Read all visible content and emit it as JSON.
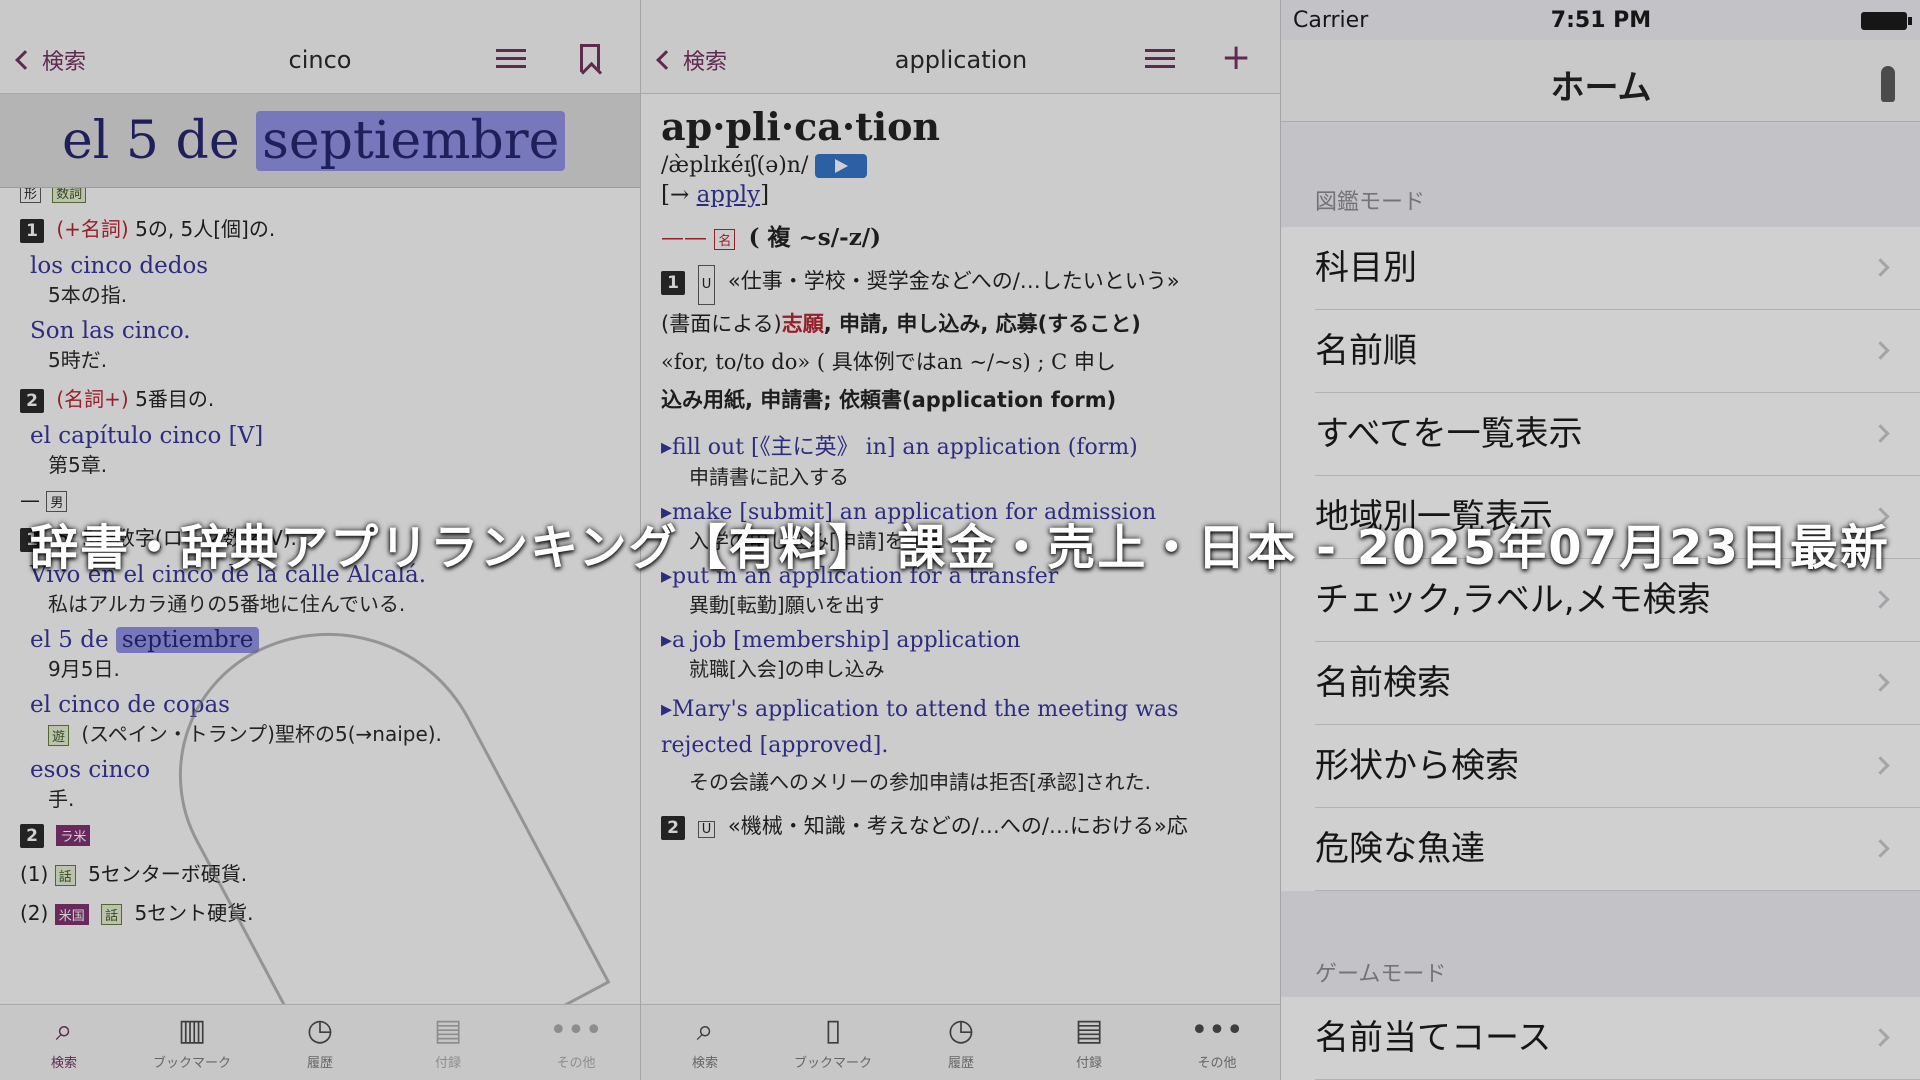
{
  "banner": "辞書・辞典アプリランキング【有料】 課金・売上・日本 - 2025年07月23日最新",
  "left": {
    "back_label": "検索",
    "title": "cinco",
    "magnifier": {
      "prefix": "el 5 de ",
      "highlight": "septiembre"
    },
    "entries": {
      "tags_top": [
        "形",
        "数詞"
      ],
      "s1_num": "1",
      "s1_head": "(+名詞)",
      "s1_text": "5の, 5人[個]の.",
      "e1_en": "los cinco dedos",
      "e1_jp": "5本の指.",
      "e2_en": "Son las cinco.",
      "e2_jp": "5時だ.",
      "s2_num": "2",
      "s2_head": "(名詞+)",
      "s2_text": "5番目の.",
      "e3_en": "el capítulo cinco [V]",
      "e3_jp": "第5章.",
      "male_tag": "男",
      "s3_num": "1",
      "s3_text": "5; 5の数字(ローマ数字 V).",
      "e4_en": "Vivo en el cinco de la calle Alcalá.",
      "e4_jp": "私はアルカラ通りの5番地に住んでいる.",
      "e5_en_a": "el 5 de ",
      "e5_en_hl": "septiembre",
      "e5_jp": "9月5日.",
      "e6_en": "el cinco de copas",
      "e6_tag": "遊",
      "e6_jp": "(スペイン・トランプ)聖杯の5(→naipe).",
      "e7_en": "esos cinco",
      "e7_jp": "手.",
      "s4_num": "2",
      "s4_tag": "ラ米",
      "s4a_label": "(1)",
      "s4a_tag": "話",
      "s4a_text": "5センターボ硬貨.",
      "s4b_label": "(2)",
      "s4b_tag1": "米国",
      "s4b_tag2": "話",
      "s4b_text": "5セント硬貨."
    },
    "tabs": [
      "検索",
      "ブックマーク",
      "履歴",
      "付録",
      "その他"
    ]
  },
  "middle": {
    "back_label": "検索",
    "title": "application",
    "headword": "ap·pli·ca·tion",
    "pron": "/æ̀plɪkéɪʃ(ə)n/",
    "xref_label": "[→ ",
    "xref_word": "apply",
    "xref_end": "]",
    "pos": "名",
    "pos_plural": "( 複 ~s/-z/)",
    "s1_num": "1",
    "s1_box": "U",
    "s1_line1": "«仕事・学校・奨学金などへの/…したいという»",
    "s1_line2a": "(書面による)",
    "s1_line2b": "志願",
    "s1_line2c": ", 申請, 申し込み, 応募(すること)",
    "s1_line3": "«for, to/to do» ( 具体例ではan ~/~s) ; C 申し",
    "s1_line4": "込み用紙, 申請書; 依頼書(application form)",
    "ex": [
      {
        "en": "fill out [《主に英》 in] an application (form)",
        "jp": "申請書に記入する"
      },
      {
        "en": "make [submit] an application for admission",
        "jp": "入学の申し込み[申請]をする"
      },
      {
        "en": "put in an application for a transfer",
        "jp": "異動[転勤]願いを出す"
      },
      {
        "en": "a job [membership] application",
        "jp": "就職[入会]の申し込み"
      },
      {
        "en": "Mary's application to attend the meeting was rejected [approved].",
        "jp": "その会議へのメリーの参加申請は拒否[承認]された."
      }
    ],
    "s2_num": "2",
    "s2_box": "U",
    "s2_text": "«機械・知識・考えなどの/…への/…における»応",
    "tabs": [
      "検索",
      "ブックマーク",
      "履歴",
      "付録",
      "その他"
    ]
  },
  "right": {
    "carrier": "Carrier",
    "time": "7:51 PM",
    "title": "ホーム",
    "section1": "図鑑モード",
    "items1": [
      "科目別",
      "名前順",
      "すべてを一覧表示",
      "地域別一覧表示",
      "チェック,ラベル,メモ検索",
      "名前検索",
      "形状から検索",
      "危険な魚達"
    ],
    "section2": "ゲームモード",
    "items2": [
      "名前当てコース"
    ]
  }
}
